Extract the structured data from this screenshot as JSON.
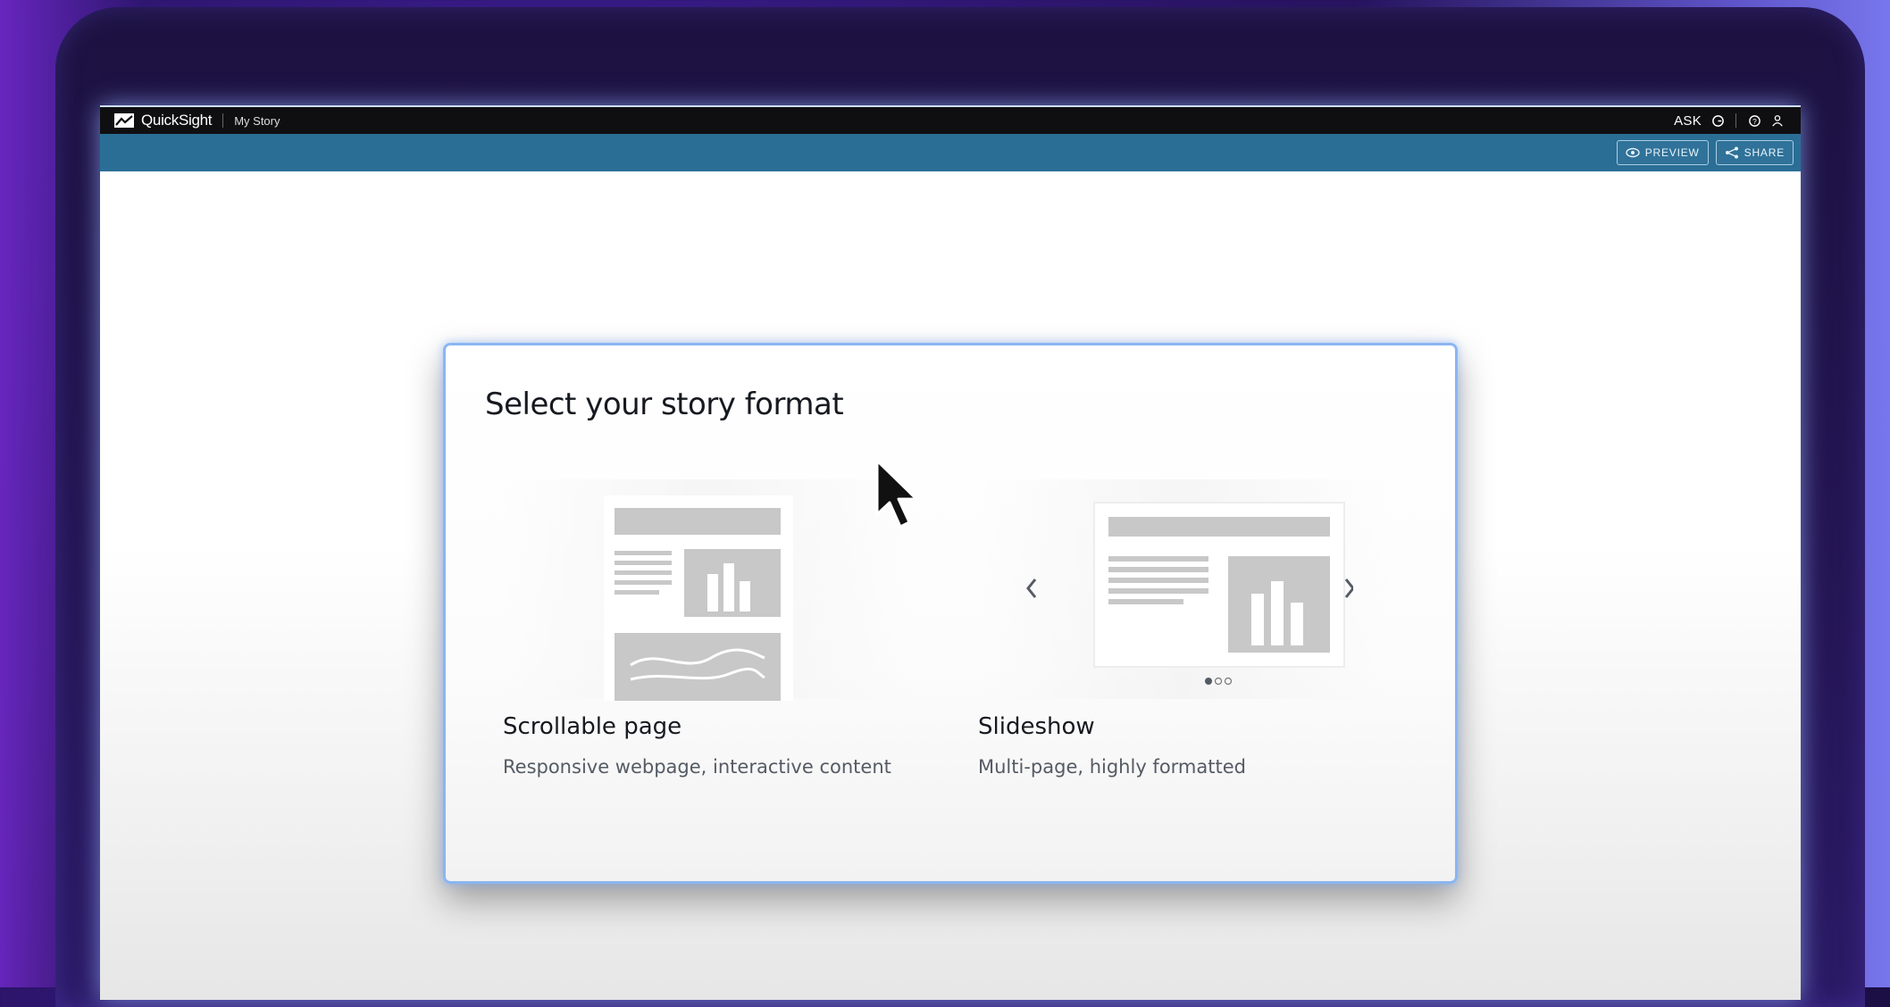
{
  "app": {
    "name": "QuickSight",
    "story_name": "My Story",
    "ask_label": "ASK"
  },
  "toolbar": {
    "preview_label": "PREVIEW",
    "share_label": "SHARE"
  },
  "dialog": {
    "title": "Select your story format",
    "options": [
      {
        "title": "Scrollable page",
        "description": "Responsive webpage, interactive content"
      },
      {
        "title": "Slideshow",
        "description": "Multi-page, highly formatted"
      }
    ]
  },
  "colors": {
    "toolbar_bg": "#2a6e96",
    "topbar_bg": "#0f0f12",
    "dialog_border": "#8bb6f0",
    "placeholder_gray": "#c8c8c8"
  },
  "icons": [
    "quicksight-logo-icon",
    "search-icon",
    "help-icon",
    "user-icon",
    "eye-icon",
    "share-icon",
    "chevron-left-icon",
    "chevron-right-icon",
    "pointer-cursor-icon"
  ]
}
